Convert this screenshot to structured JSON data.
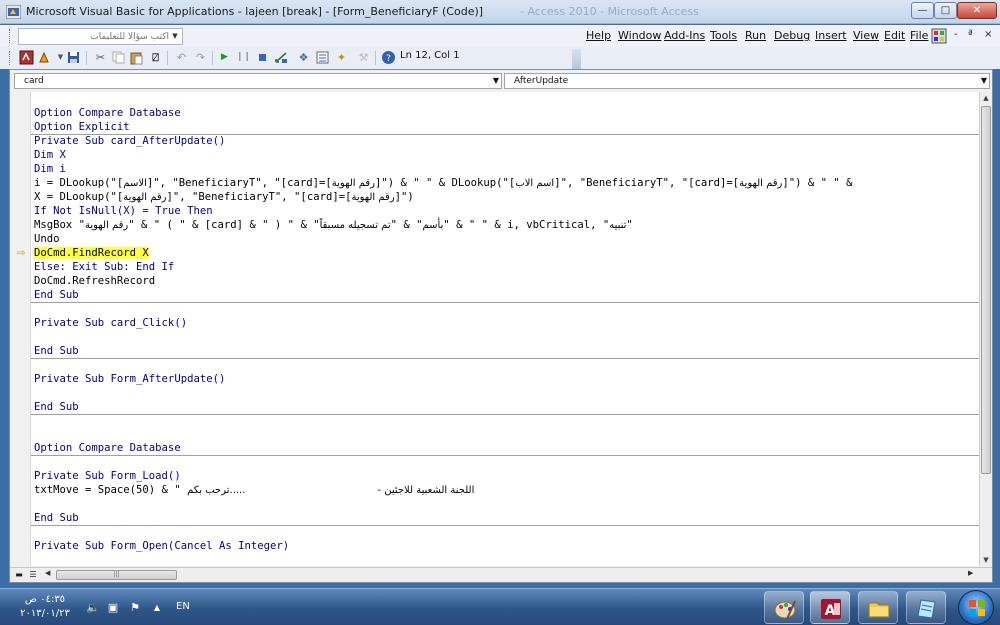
{
  "window": {
    "title": "Microsoft Visual Basic for Applications - lajeen [break] - [Form_BeneficiaryF (Code)]",
    "background_title": "- Access 2010 - Microsoft Access"
  },
  "menubar": {
    "ask_placeholder": "اكتب سؤالاً للتعليمات",
    "items": [
      "Help",
      "Window",
      "Add-Ins",
      "Tools",
      "Run",
      "Debug",
      "Insert",
      "View",
      "Edit",
      "File"
    ],
    "controls": [
      "-",
      "ª",
      "×"
    ]
  },
  "toolbar": {
    "position": "Ln 12, Col 1"
  },
  "code_window": {
    "object_combo": "card",
    "procedure_combo": "AfterUpdate"
  },
  "code": {
    "l1": "Option Compare Database",
    "l2": "Option Explicit",
    "l3": "Private Sub card_AfterUpdate()",
    "l4": "Dim X",
    "l5": "Dim i",
    "l6a": "i = DLookup(\"[",
    "l6b": "الاسم",
    "l6c": "]\", \"BeneficiaryT\", \"[card]=[",
    "l6d": "رقم الهوية",
    "l6e": "]\") & \" \" & DLookup(\"[",
    "l6f": "اسم الاب",
    "l6g": "]\", \"BeneficiaryT\", \"[card]=[",
    "l6h": "رقم الهوية",
    "l6i": "]\") & \" \" &",
    "l7a": "X = DLookup(\"[",
    "l7b": "رقم الهوية",
    "l7c": "]\", \"BeneficiaryT\", \"[card]=[",
    "l7d": "رقم الهوية",
    "l7e": "]\")",
    "l8": "If Not IsNull(X) = True Then",
    "l9a": "MsgBox \"",
    "l9b": "رقم الهوية",
    "l9c": "\" & \" ( \" & [card] & \" ) \" & \"",
    "l9d": "تم تسجيله مسبقاً",
    "l9e": "\" & \"",
    "l9f": "بأسم",
    "l9g": "\" & \" \" & i, vbCritical, \"",
    "l9h": "تنبيه",
    "l9i": "\"",
    "l10": "Undo",
    "l11": "DoCmd.FindRecord X",
    "l12": "Else: Exit Sub: End If",
    "l13": "DoCmd.RefreshRecord",
    "l14": "End Sub",
    "l15": "Private Sub card_Click()",
    "l16": "End Sub",
    "l17": "Private Sub Form_AfterUpdate()",
    "l18": "End Sub",
    "l19": "Option Compare Database",
    "l20": "Private Sub Form_Load()",
    "l21a": "txtMove = Space(50) & \" ",
    "l21b": ".....ترحب بكم",
    "l21c": "اللجنة الشعبية للاجئين -",
    "l22": "End Sub",
    "l23": "Private Sub Form_Open(Cancel As Integer)"
  },
  "taskbar": {
    "time": "٠٤:٣٥ ص",
    "date": "٢٠١٣/٠١/٢٣",
    "language": "EN"
  },
  "colors": {
    "keyword": "#00008b",
    "highlight": "#ffff3c",
    "taskbar": "#2f5688"
  }
}
